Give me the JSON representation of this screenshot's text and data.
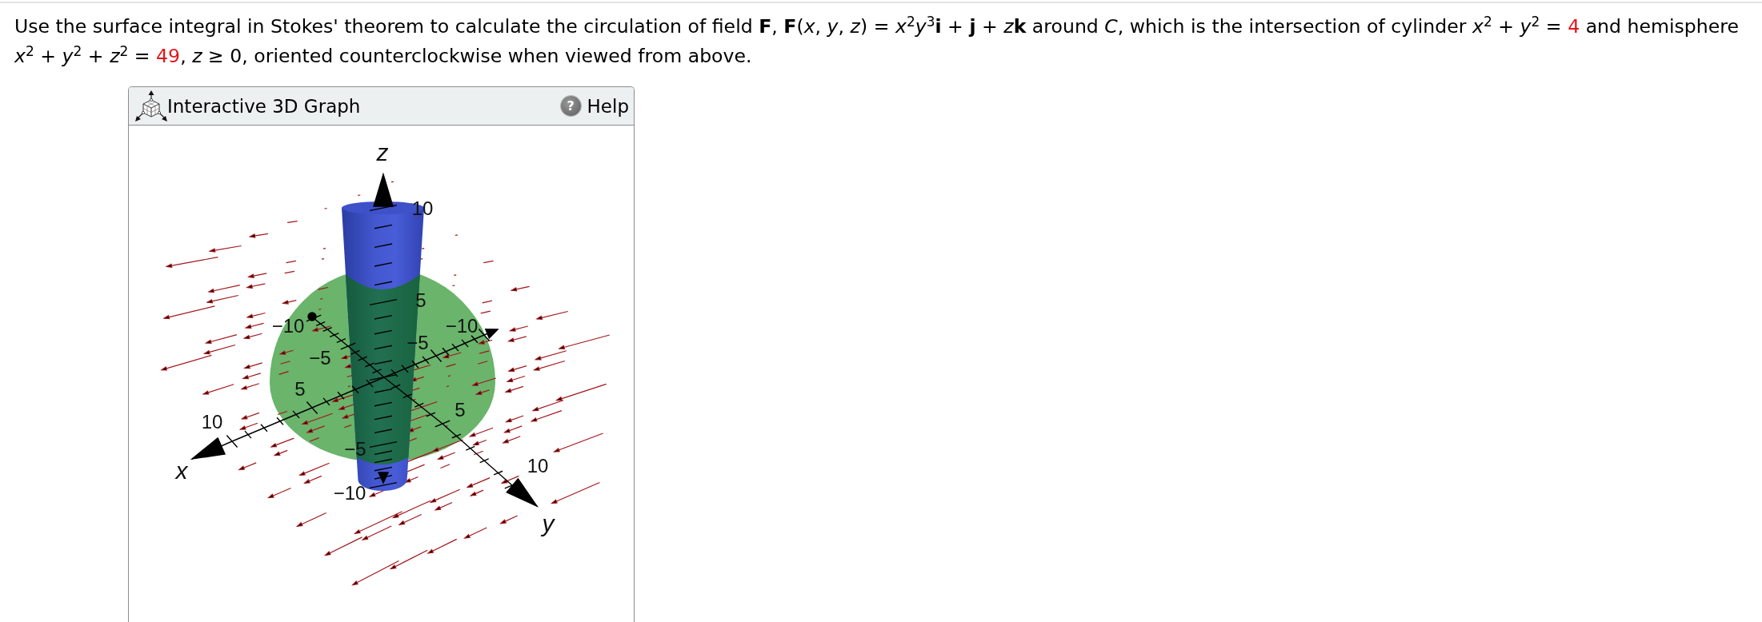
{
  "question": {
    "segments": [
      {
        "kind": "plain",
        "text": "Use the surface integral in Stokes' theorem to calculate the circulation of field **F**, **F**(*x*, *y*, *z*) = *x*$^{2}$*y*$^{3}$**i** + **j** + *z*"
      },
      {
        "kind": "plain",
        "text": "**k** around *C*, which is the intersection of cylinder *x*$^{2}$ + *y*$^{2}$ = "
      },
      {
        "kind": "given",
        "text": "4"
      },
      {
        "kind": "plain",
        "text": " and hemisphere *x*$^{2}$ + *y*$^{2}$ + *z*$^{2}$ = "
      },
      {
        "kind": "given",
        "text": "49"
      },
      {
        "kind": "plain",
        "text": ", *z* ≥ 0, oriented counterclockwise when viewed from above."
      }
    ]
  },
  "graph": {
    "title": "Interactive 3D Graph",
    "help": {
      "icon": "?",
      "label": "Help"
    },
    "axes": [
      {
        "label": "z",
        "ticks": [
          "10",
          "5",
          "−5",
          "−10"
        ]
      },
      {
        "label": "x",
        "ticks": [
          "−10",
          "−5",
          "5",
          "10"
        ]
      },
      {
        "label": "y",
        "ticks": [
          "−10",
          "−5",
          "5",
          "10"
        ]
      }
    ]
  }
}
